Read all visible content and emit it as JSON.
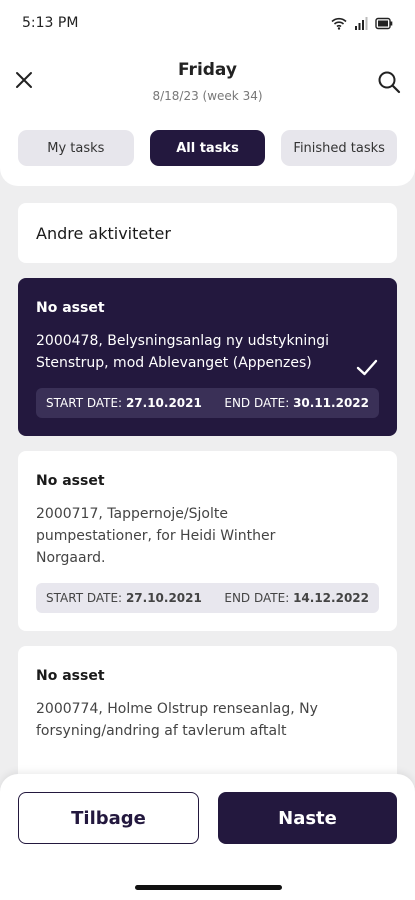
{
  "status": {
    "time": "5:13 PM",
    "icons": [
      "wifi-icon",
      "signal-icon",
      "battery-icon"
    ]
  },
  "header": {
    "title": "Friday",
    "subtitle": "8/18/23 (week 34)",
    "tabs": [
      {
        "label": "My tasks",
        "active": false
      },
      {
        "label": "All tasks",
        "active": true
      },
      {
        "label": "Finished tasks",
        "active": false
      }
    ]
  },
  "list": {
    "andre": "Andre aktiviteter",
    "tasks": [
      {
        "asset": "No asset",
        "desc": "2000478, Belysningsanlag ny udstykningi Stenstrup, mod Ablevanget (Appenzes)",
        "start_label": "START DATE:",
        "start_value": "27.10.2021",
        "end_label": "END DATE:",
        "end_value": "30.11.2022",
        "selected": true
      },
      {
        "asset": "No asset",
        "desc": "2000717, Tappernoje/Sjolte pumpestationer, for Heidi Winther Norgaard.",
        "start_label": "START DATE:",
        "start_value": "27.10.2021",
        "end_label": "END DATE:",
        "end_value": "14.12.2022",
        "selected": false
      },
      {
        "asset": "No asset",
        "desc": "2000774, Holme Olstrup renseanlag, Ny forsyning/andring af tavlerum aftalt",
        "selected": false
      }
    ]
  },
  "footer": {
    "back_label": "Tilbage",
    "next_label": "Naste"
  },
  "colors": {
    "primary": "#23183e",
    "background": "#eeeeef",
    "tab_inactive": "#e7e6ec"
  }
}
